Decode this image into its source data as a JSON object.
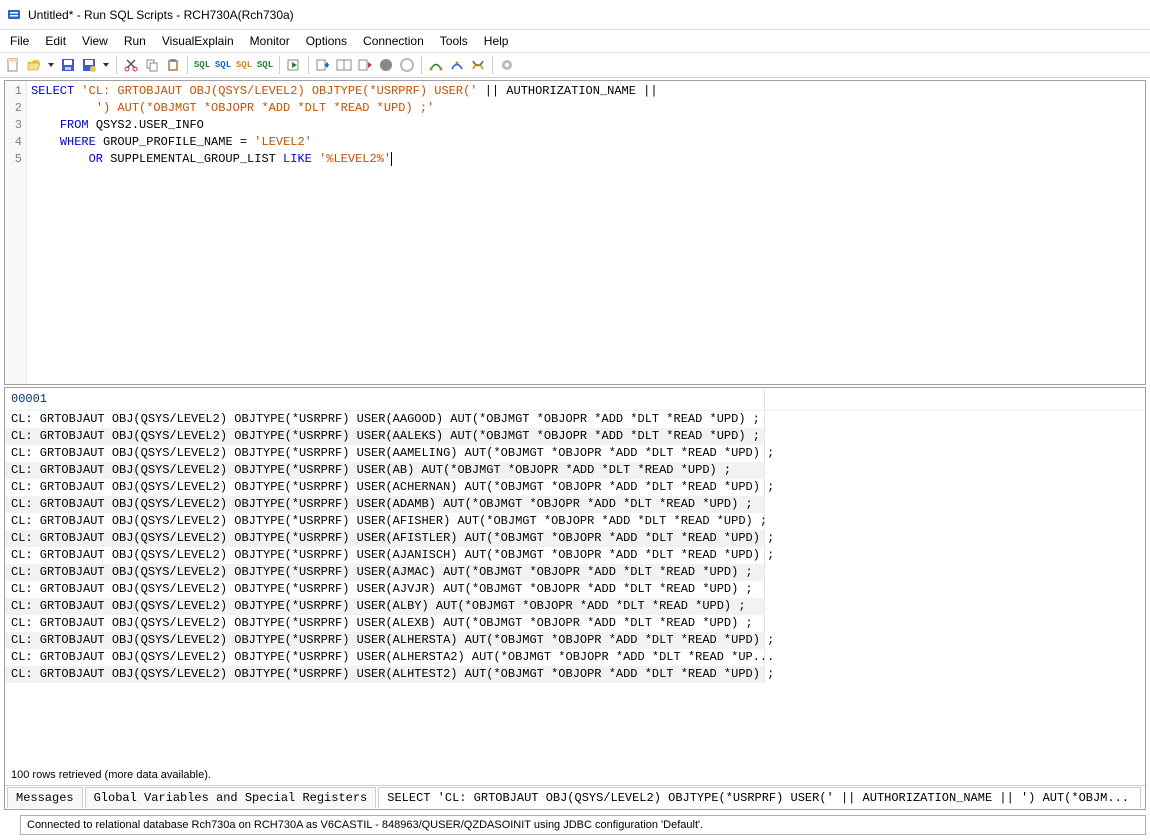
{
  "window": {
    "title": "Untitled* - Run SQL Scripts - RCH730A(Rch730a)"
  },
  "menu": {
    "items": [
      "File",
      "Edit",
      "View",
      "Run",
      "VisualExplain",
      "Monitor",
      "Options",
      "Connection",
      "Tools",
      "Help"
    ]
  },
  "toolbar": {
    "icons": [
      "new",
      "open",
      "dropdown",
      "save",
      "save-as",
      "sep",
      "cut",
      "copy",
      "paste",
      "sep",
      "sql1",
      "sql2",
      "sql3",
      "sql4",
      "sep",
      "run",
      "sep",
      "run-sel",
      "run-all",
      "run-from",
      "stop-circ",
      "stop-grey",
      "sep",
      "explain1",
      "explain2",
      "explain3",
      "sep",
      "gear"
    ]
  },
  "editor": {
    "lines": [
      {
        "n": "1",
        "tokens": [
          {
            "t": "kw",
            "v": "SELECT "
          },
          {
            "t": "str",
            "v": "'CL: GRTOBJAUT OBJ(QSYS/LEVEL2) OBJTYPE(*USRPRF) USER('"
          },
          {
            "t": "ident",
            "v": " || AUTHORIZATION_NAME ||"
          }
        ]
      },
      {
        "n": "2",
        "tokens": [
          {
            "t": "ident",
            "v": "         "
          },
          {
            "t": "str",
            "v": "') AUT(*OBJMGT *OBJOPR *ADD *DLT *READ *UPD) ;'"
          }
        ]
      },
      {
        "n": "3",
        "tokens": [
          {
            "t": "ident",
            "v": "    "
          },
          {
            "t": "kw",
            "v": "FROM"
          },
          {
            "t": "ident",
            "v": " QSYS2.USER_INFO"
          }
        ]
      },
      {
        "n": "4",
        "tokens": [
          {
            "t": "ident",
            "v": "    "
          },
          {
            "t": "kw",
            "v": "WHERE"
          },
          {
            "t": "ident",
            "v": " GROUP_PROFILE_NAME = "
          },
          {
            "t": "str",
            "v": "'LEVEL2'"
          }
        ]
      },
      {
        "n": "5",
        "tokens": [
          {
            "t": "ident",
            "v": "        "
          },
          {
            "t": "kw",
            "v": "OR"
          },
          {
            "t": "ident",
            "v": " SUPPLEMENTAL_GROUP_LIST "
          },
          {
            "t": "kw",
            "v": "LIKE "
          },
          {
            "t": "str",
            "v": "'%LEVEL2%'"
          }
        ]
      }
    ]
  },
  "results": {
    "header": "00001",
    "rows": [
      "CL: GRTOBJAUT OBJ(QSYS/LEVEL2) OBJTYPE(*USRPRF) USER(AAGOOD) AUT(*OBJMGT *OBJOPR *ADD *DLT *READ *UPD) ;",
      "CL: GRTOBJAUT OBJ(QSYS/LEVEL2) OBJTYPE(*USRPRF) USER(AALEKS) AUT(*OBJMGT *OBJOPR *ADD *DLT *READ *UPD) ;",
      "CL: GRTOBJAUT OBJ(QSYS/LEVEL2) OBJTYPE(*USRPRF) USER(AAMELING) AUT(*OBJMGT *OBJOPR *ADD *DLT *READ *UPD) ;",
      "CL: GRTOBJAUT OBJ(QSYS/LEVEL2) OBJTYPE(*USRPRF) USER(AB) AUT(*OBJMGT *OBJOPR *ADD *DLT *READ *UPD) ;",
      "CL: GRTOBJAUT OBJ(QSYS/LEVEL2) OBJTYPE(*USRPRF) USER(ACHERNAN) AUT(*OBJMGT *OBJOPR *ADD *DLT *READ *UPD) ;",
      "CL: GRTOBJAUT OBJ(QSYS/LEVEL2) OBJTYPE(*USRPRF) USER(ADAMB) AUT(*OBJMGT *OBJOPR *ADD *DLT *READ *UPD) ;",
      "CL: GRTOBJAUT OBJ(QSYS/LEVEL2) OBJTYPE(*USRPRF) USER(AFISHER) AUT(*OBJMGT *OBJOPR *ADD *DLT *READ *UPD) ;",
      "CL: GRTOBJAUT OBJ(QSYS/LEVEL2) OBJTYPE(*USRPRF) USER(AFISTLER) AUT(*OBJMGT *OBJOPR *ADD *DLT *READ *UPD) ;",
      "CL: GRTOBJAUT OBJ(QSYS/LEVEL2) OBJTYPE(*USRPRF) USER(AJANISCH) AUT(*OBJMGT *OBJOPR *ADD *DLT *READ *UPD) ;",
      "CL: GRTOBJAUT OBJ(QSYS/LEVEL2) OBJTYPE(*USRPRF) USER(AJMAC) AUT(*OBJMGT *OBJOPR *ADD *DLT *READ *UPD) ;",
      "CL: GRTOBJAUT OBJ(QSYS/LEVEL2) OBJTYPE(*USRPRF) USER(AJVJR) AUT(*OBJMGT *OBJOPR *ADD *DLT *READ *UPD) ;",
      "CL: GRTOBJAUT OBJ(QSYS/LEVEL2) OBJTYPE(*USRPRF) USER(ALBY) AUT(*OBJMGT *OBJOPR *ADD *DLT *READ *UPD) ;",
      "CL: GRTOBJAUT OBJ(QSYS/LEVEL2) OBJTYPE(*USRPRF) USER(ALEXB) AUT(*OBJMGT *OBJOPR *ADD *DLT *READ *UPD) ;",
      "CL: GRTOBJAUT OBJ(QSYS/LEVEL2) OBJTYPE(*USRPRF) USER(ALHERSTA) AUT(*OBJMGT *OBJOPR *ADD *DLT *READ *UPD) ;",
      "CL: GRTOBJAUT OBJ(QSYS/LEVEL2) OBJTYPE(*USRPRF) USER(ALHERSTA2) AUT(*OBJMGT *OBJOPR *ADD *DLT *READ *UP...",
      "CL: GRTOBJAUT OBJ(QSYS/LEVEL2) OBJTYPE(*USRPRF) USER(ALHTEST2) AUT(*OBJMGT *OBJOPR *ADD *DLT *READ *UPD) ;"
    ],
    "status": "100 rows retrieved (more data available)."
  },
  "tabs": {
    "messages": "Messages",
    "globals": "Global Variables and Special Registers",
    "query": "SELECT 'CL: GRTOBJAUT OBJ(QSYS/LEVEL2) OBJTYPE(*USRPRF) USER(' || AUTHORIZATION_NAME || ') AUT(*OBJM..."
  },
  "statusbar": {
    "text": "Connected to relational database Rch730a on RCH730A as V6CASTIL - 848963/QUSER/QZDASOINIT using JDBC configuration 'Default'."
  }
}
